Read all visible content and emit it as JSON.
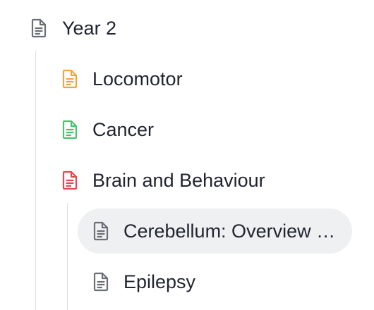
{
  "tree": {
    "root": {
      "label": "Year 2",
      "icon": "document-icon",
      "color": "#6b6f76"
    },
    "children": [
      {
        "label": "Locomotor",
        "icon": "document-icon",
        "color": "#f0a640"
      },
      {
        "label": "Cancer",
        "icon": "document-icon",
        "color": "#4cc36d"
      },
      {
        "label": "Brain and Behaviour",
        "icon": "document-icon",
        "color": "#e5484d"
      }
    ],
    "grandchildren": [
      {
        "label": "Cerebellum: Overview & Function",
        "icon": "document-icon",
        "color": "#6b6f76",
        "selected": true
      },
      {
        "label": "Epilepsy",
        "icon": "document-icon",
        "color": "#6b6f76",
        "selected": false
      }
    ]
  }
}
